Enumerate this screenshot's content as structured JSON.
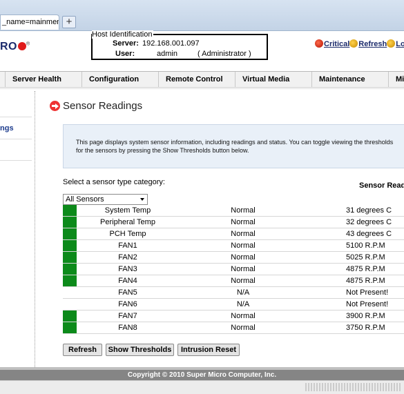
{
  "browser": {
    "tab_title": "_name=mainmenu",
    "new_tab_label": "+"
  },
  "header": {
    "logo_text": "RO",
    "logo_reg": "®",
    "host_identification": {
      "legend": "Host Identification",
      "server_label": "Server:",
      "server_value": "192.168.001.097",
      "user_label": "User:",
      "user_value": "admin",
      "user_role": "( Administrator )"
    },
    "links": {
      "critical": "Critical",
      "refresh": "Refresh",
      "logout": "Lo"
    }
  },
  "nav": {
    "items": [
      "Server Health",
      "Configuration",
      "Remote Control",
      "Virtual Media",
      "Maintenance",
      "Mis"
    ]
  },
  "sidebar": {
    "item": "ngs"
  },
  "main": {
    "title": "Sensor Readings",
    "info_text": "This page displays system sensor information, including readings and status. You can toggle viewing the thresholds for the sensors by pressing the Show Thresholds button below.",
    "category_label": "Select a sensor type category:",
    "sensor_readings_label": "Sensor Readi",
    "category_selected": "All Sensors",
    "sensors": [
      {
        "name": "System Temp",
        "status": "Normal",
        "reading": "31 degrees C",
        "ok": true
      },
      {
        "name": "Peripheral Temp",
        "status": "Normal",
        "reading": "32 degrees C",
        "ok": true
      },
      {
        "name": "PCH Temp",
        "status": "Normal",
        "reading": "43 degrees C",
        "ok": true
      },
      {
        "name": "FAN1",
        "status": "Normal",
        "reading": "5100 R.P.M",
        "ok": true
      },
      {
        "name": "FAN2",
        "status": "Normal",
        "reading": "5025 R.P.M",
        "ok": true
      },
      {
        "name": "FAN3",
        "status": "Normal",
        "reading": "4875 R.P.M",
        "ok": true
      },
      {
        "name": "FAN4",
        "status": "Normal",
        "reading": "4875 R.P.M",
        "ok": true
      },
      {
        "name": "FAN5",
        "status": "N/A",
        "reading": "Not Present!",
        "ok": false
      },
      {
        "name": "FAN6",
        "status": "N/A",
        "reading": "Not Present!",
        "ok": false
      },
      {
        "name": "FAN7",
        "status": "Normal",
        "reading": "3900 R.P.M",
        "ok": true
      },
      {
        "name": "FAN8",
        "status": "Normal",
        "reading": "3750 R.P.M",
        "ok": true
      }
    ],
    "buttons": {
      "refresh": "Refresh",
      "show_thresholds": "Show Thresholds",
      "intrusion_reset": "Intrusion Reset"
    }
  },
  "footer": {
    "copyright": "Copyright © 2010 Super Micro Computer, Inc."
  },
  "colors": {
    "status_ok": "#0c8a1a",
    "brand_blue": "#1b2a6b",
    "brand_red": "#e01b1b"
  }
}
